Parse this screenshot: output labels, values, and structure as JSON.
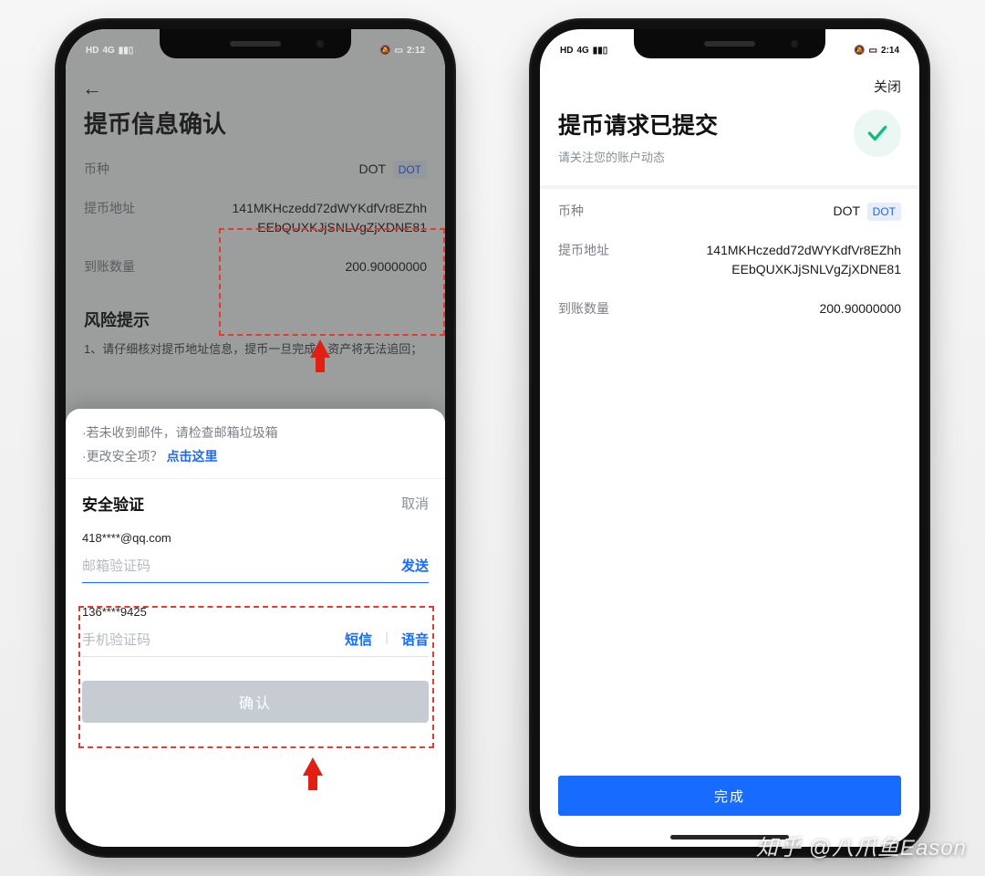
{
  "status": {
    "left_time": "2:12",
    "right_time": "2:14",
    "carrier_badge": "HD",
    "signal": "4G",
    "bell": "🔕",
    "battery": "▢"
  },
  "left": {
    "back_icon": "←",
    "page_title": "提币信息确认",
    "labels": {
      "coin": "币种",
      "address": "提币地址",
      "amount": "到账数量"
    },
    "values": {
      "coin": "DOT",
      "chain_badge": "DOT",
      "address_line1": "141MKHczedd72dWYKdfVr8EZhh",
      "address_line2": "EEbQUXKJjSNLVgZjXDNE81",
      "amount": "200.90000000"
    },
    "risk_title": "风险提示",
    "risk_body": "1、请仔细核对提币地址信息，提币一旦完成，资产将无法追回；",
    "sheet": {
      "hint_mail": "·若未收到邮件，请检查邮箱垃圾箱",
      "hint_change_prefix": "·更改安全项？",
      "hint_change_link": "点击这里",
      "title": "安全验证",
      "cancel": "取消",
      "email_mask": "418****@qq.com",
      "email_ph": "邮箱验证码",
      "email_send": "发送",
      "phone_mask": "136****9425",
      "phone_ph": "手机验证码",
      "phone_sms": "短信",
      "phone_voice": "语音",
      "confirm": "确认"
    }
  },
  "right": {
    "close": "关闭",
    "title": "提币请求已提交",
    "subtitle": "请关注您的账户动态",
    "labels": {
      "coin": "币种",
      "address": "提币地址",
      "amount": "到账数量"
    },
    "values": {
      "coin": "DOT",
      "chain_badge": "DOT",
      "address_line1": "141MKHczedd72dWYKdfVr8EZhh",
      "address_line2": "EEbQUXKJjSNLVgZjXDNE81",
      "amount": "200.90000000"
    },
    "done": "完成"
  },
  "watermark": "知乎 @八爪鱼Eason"
}
